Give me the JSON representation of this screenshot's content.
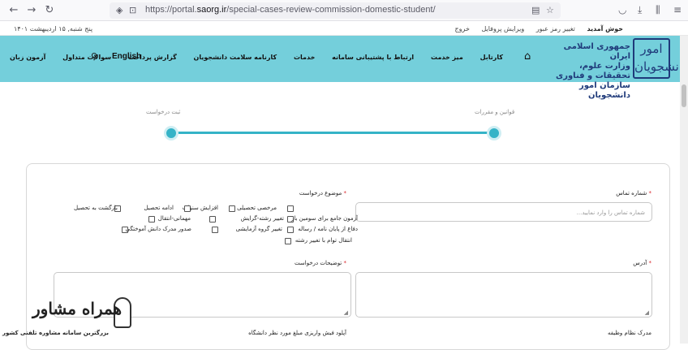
{
  "browser": {
    "back_icon": "←",
    "forward_icon": "→",
    "reload_icon": "↻",
    "url_prefix": "https://portal.",
    "url_domain": "saorg.ir",
    "url_path": "/special-cases-review-commission-domestic-student/"
  },
  "topbar": {
    "date": "پنج شنبه, ۱۵ اردیبهشت ۱۴۰۱",
    "welcome": "خوش آمدید",
    "change_password": "تغییر رمز عبور",
    "edit_profile": "ویرایش پروفایل",
    "logout": "خروج"
  },
  "header": {
    "logo_text": "امور دانشجویان",
    "org_line1": "جمهوری اسلامی ایران",
    "org_line2": "وزارت علوم، تحقیقات و فناوری",
    "org_line3": "سازمان امور دانشجویان",
    "menu": [
      "کارتابل",
      "میز خدمت",
      "ارتباط با پشتیبانی سامانه",
      "خدمات",
      "کارنامه سلامت دانشجویان",
      "گزارش پرداخت",
      "سوالات متداول",
      "آزمون زبان"
    ],
    "english": "English"
  },
  "steps": {
    "step1": "قوانین و مقررات",
    "step2": "ثبت درخواست"
  },
  "form": {
    "tracking_label": "شماره تماس",
    "tracking_placeholder": "شماره تماس را وارد نمایید...",
    "subject_label": "موضوع درخواست",
    "options": [
      "مرخصی تحصیلی",
      "افزایش سنوات",
      "ادامه تحصیل",
      "بازگشت به تحصیل",
      "آزمون جامع برای سومین بار",
      "تغییر رشته-گرایش",
      "مهمانی-انتقال",
      "دفاع از پایان نامه / رساله",
      "تغییر گروه آزمایشی",
      "صدور مدرک دانش آموختگی",
      "انتقال توام با تغییر رشته"
    ],
    "address_label": "آدرس",
    "description_label": "توضیحات درخواست",
    "military_label": "مدرک نظام وظیفه",
    "upload_label": "آپلود فیش واریزی مبلغ مورد نظر دانشگاه"
  },
  "watermark": {
    "title": "همراه مشاور",
    "subtitle": "بزرگترین سامانه مشاوره تلفنی کشور"
  }
}
